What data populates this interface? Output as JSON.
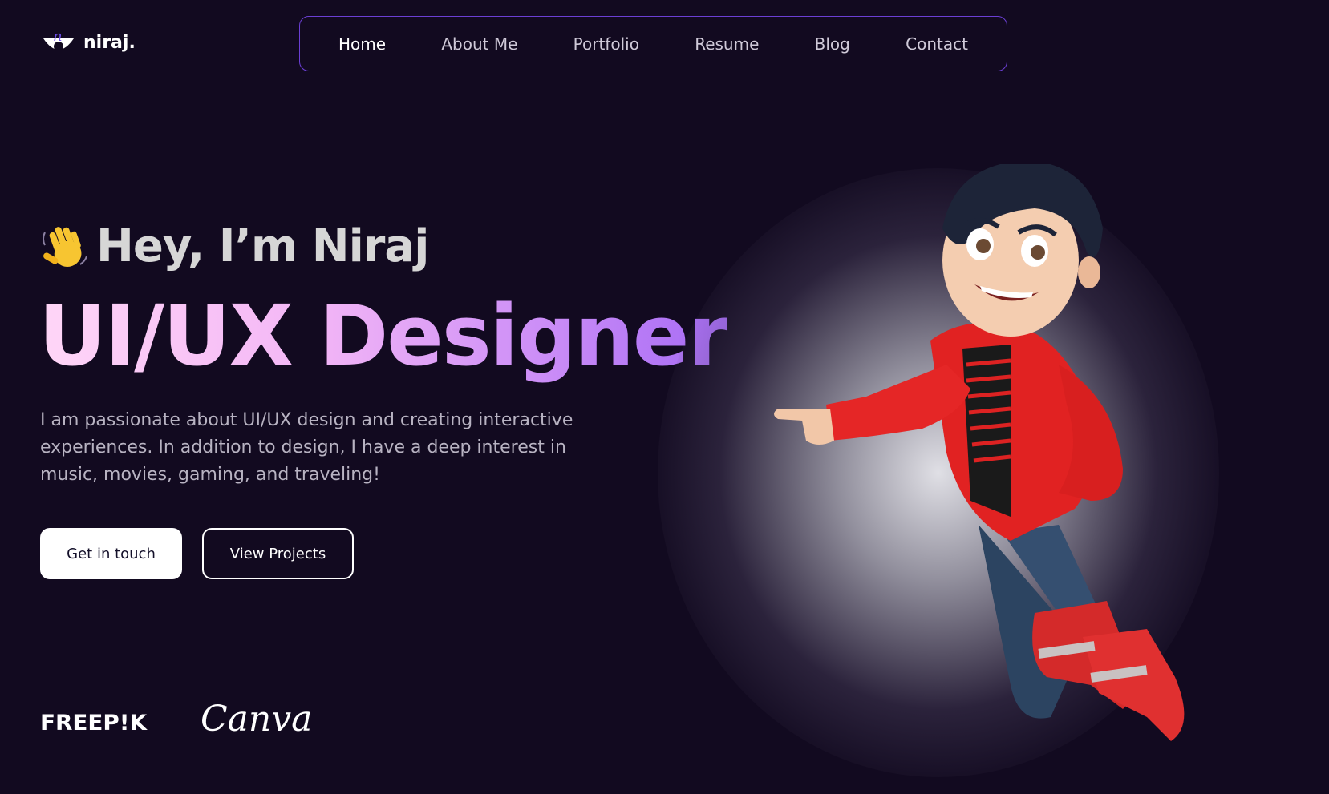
{
  "brand": {
    "name": "niraj.",
    "logo_letter": "n"
  },
  "nav": {
    "items": [
      {
        "label": "Home",
        "active": true
      },
      {
        "label": "About Me",
        "active": false
      },
      {
        "label": "Portfolio",
        "active": false
      },
      {
        "label": "Resume",
        "active": false
      },
      {
        "label": "Blog",
        "active": false
      },
      {
        "label": "Contact",
        "active": false
      }
    ]
  },
  "hero": {
    "greeting": "Hey, I’m Niraj",
    "headline": "UI/UX Designer",
    "intro_lines": [
      "I am passionate about UI/UX design and creating interactive",
      "experiences. In addition to design, I have a deep interest in",
      "music, movies, gaming, and traveling!"
    ],
    "primary_button": "Get in touch",
    "secondary_button": "View Projects"
  },
  "partners": {
    "freepik": "FREEP!K",
    "canva": "Canva"
  },
  "icons": {
    "wave": "waving-hand-icon",
    "logo": "niraj-logo-icon"
  },
  "colors": {
    "background": "#120a20",
    "nav_border": "#6b3fd4",
    "headline_start": "#ffd6f7",
    "headline_end": "#a56af4",
    "button_bg": "#ffffff",
    "button_text": "#14102a"
  }
}
